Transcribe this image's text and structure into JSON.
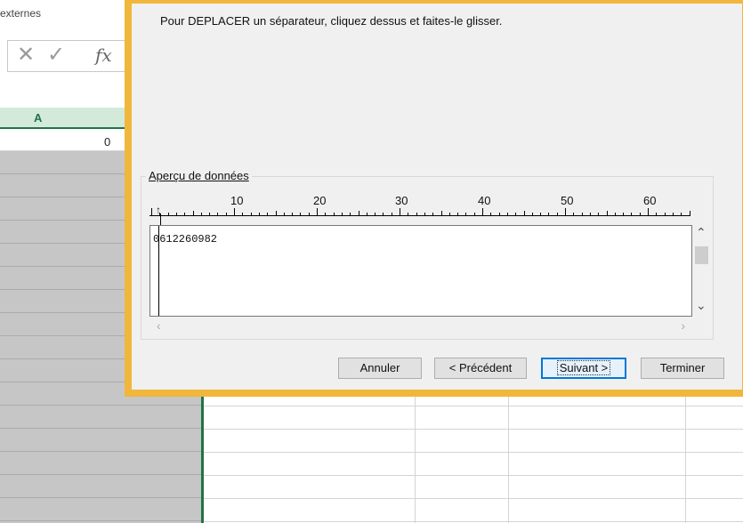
{
  "excel": {
    "ribbon_fragment": "externes",
    "formula_bar": {
      "cancel_glyph": "✕",
      "enter_glyph": "✓",
      "fx_label": "fx"
    },
    "column_header": "A",
    "cell_value": "0"
  },
  "dialog": {
    "instruction": "Pour DEPLACER un séparateur, cliquez dessus et faites-le glisser.",
    "preview": {
      "label": "Aperçu de données",
      "ruler_numbers": [
        "10",
        "20",
        "30",
        "40",
        "50",
        "60"
      ],
      "data_line": "0612260982"
    },
    "buttons": {
      "cancel": "Annuler",
      "previous": "< Précédent",
      "next": "Suivant >",
      "finish": "Terminer"
    }
  },
  "colors": {
    "dialog_frame": "#f0b73c",
    "excel_green": "#217346",
    "selection_gray": "#c6c6c6"
  }
}
